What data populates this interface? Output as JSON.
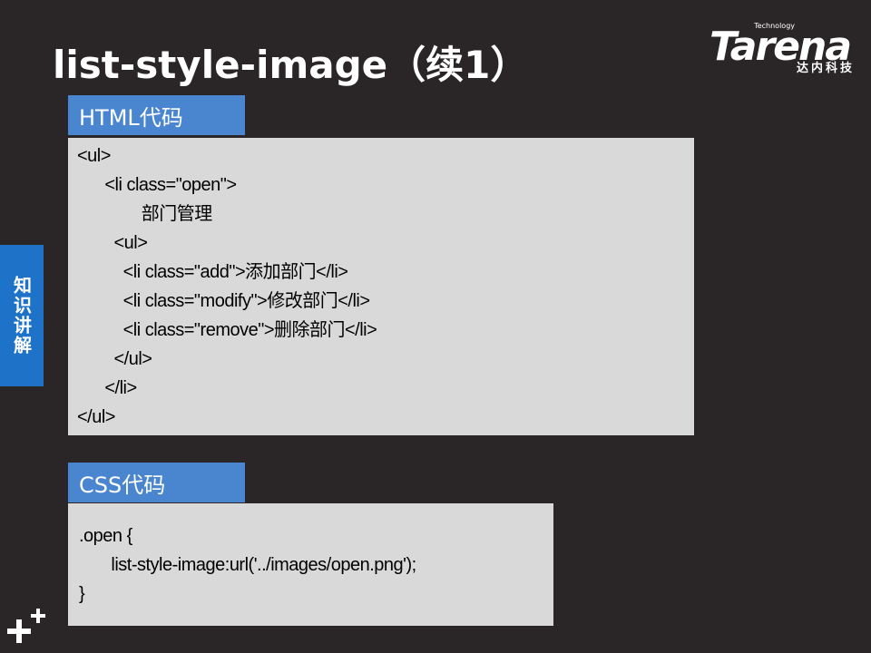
{
  "slide": {
    "title": "list-style-image（续1）",
    "logo": {
      "tech": "Technology",
      "main": "Tarena",
      "sub": "达内科技"
    },
    "side_tab": "知识讲解",
    "html_label": "HTML代码",
    "css_label": "CSS代码",
    "html_code": [
      "<ul>",
      "      <li class=\"open\">",
      "              部门管理",
      "        <ul>",
      "          <li class=\"add\">添加部门</li>",
      "          <li class=\"modify\">修改部门</li>",
      "          <li class=\"remove\">删除部门</li>",
      "        </ul>",
      "      </li>",
      "</ul>"
    ],
    "css_code": [
      ".open {",
      "       list-style-image:url('../images/open.png');",
      "}"
    ]
  }
}
